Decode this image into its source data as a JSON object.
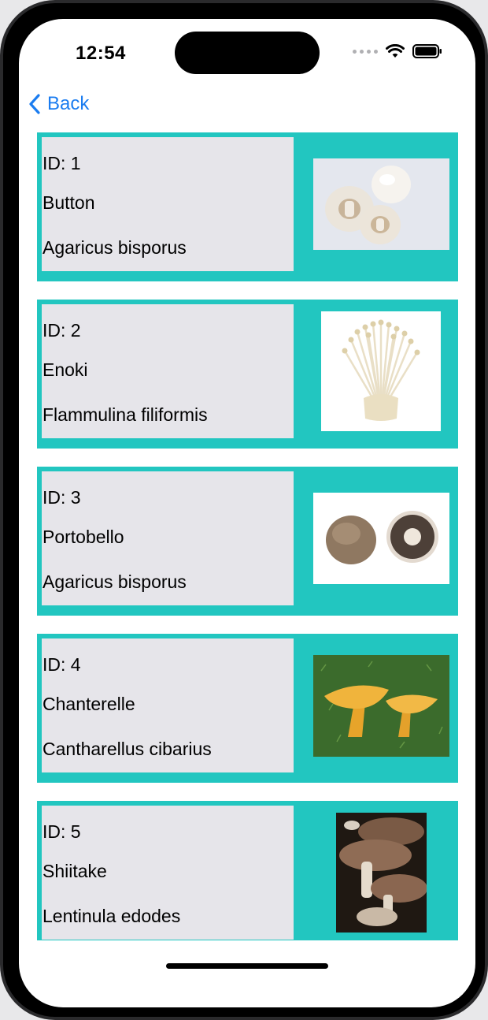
{
  "status_bar": {
    "time": "12:54"
  },
  "nav": {
    "back_label": "Back"
  },
  "mushrooms": [
    {
      "id_label": "ID: 1",
      "name": "Button",
      "scientific_name": "Agaricus bisporus",
      "image": "button-mushroom-image"
    },
    {
      "id_label": "ID: 2",
      "name": "Enoki",
      "scientific_name": "Flammulina filiformis",
      "image": "enoki-mushroom-image"
    },
    {
      "id_label": "ID: 3",
      "name": "Portobello",
      "scientific_name": "Agaricus bisporus",
      "image": "portobello-mushroom-image"
    },
    {
      "id_label": "ID: 4",
      "name": "Chanterelle",
      "scientific_name": "Cantharellus cibarius",
      "image": "chanterelle-mushroom-image"
    },
    {
      "id_label": "ID: 5",
      "name": "Shiitake",
      "scientific_name": "Lentinula edodes",
      "image": "shiitake-mushroom-image"
    }
  ],
  "colors": {
    "card_background": "#22c6c0",
    "info_panel": "#e6e5ea",
    "accent": "#1a7cf0"
  }
}
